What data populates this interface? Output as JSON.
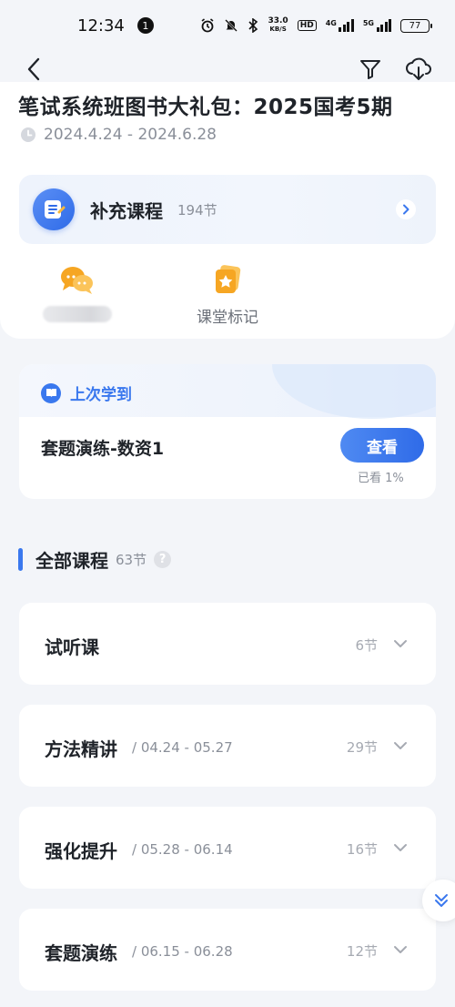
{
  "status_bar": {
    "time": "12:34",
    "notification_count": "1",
    "net_speed": "33.0",
    "net_speed_unit": "KB/S",
    "hd_label": "HD",
    "net_type_1": "4G",
    "net_type_2": "5G",
    "battery": "77"
  },
  "header": {
    "title": "笔试系统班图书大礼包：2025国考5期",
    "date_range": "2024.4.24 - 2024.6.28"
  },
  "supplementary": {
    "label": "补充课程",
    "count": "194节"
  },
  "quick_actions": [
    {
      "label": "",
      "icon": "chat-icon"
    },
    {
      "label": "课堂标记",
      "icon": "bookmark-star-icon"
    }
  ],
  "last_learned": {
    "tag": "上次学到",
    "lesson": "套题演练-数资1",
    "button": "查看",
    "progress_text": "已看 1%"
  },
  "all_courses": {
    "title": "全部课程",
    "count": "63节",
    "help": "?"
  },
  "chapters": [
    {
      "name": "试听课",
      "dates": "",
      "count": "6节"
    },
    {
      "name": "方法精讲",
      "dates": "/ 04.24 - 05.27",
      "count": "29节"
    },
    {
      "name": "强化提升",
      "dates": "/ 05.28 - 06.14",
      "count": "16节"
    },
    {
      "name": "套题演练",
      "dates": "/ 06.15 - 06.28",
      "count": "12节"
    }
  ],
  "colors": {
    "accent": "#3a78ee",
    "background": "#f3f5f9"
  }
}
